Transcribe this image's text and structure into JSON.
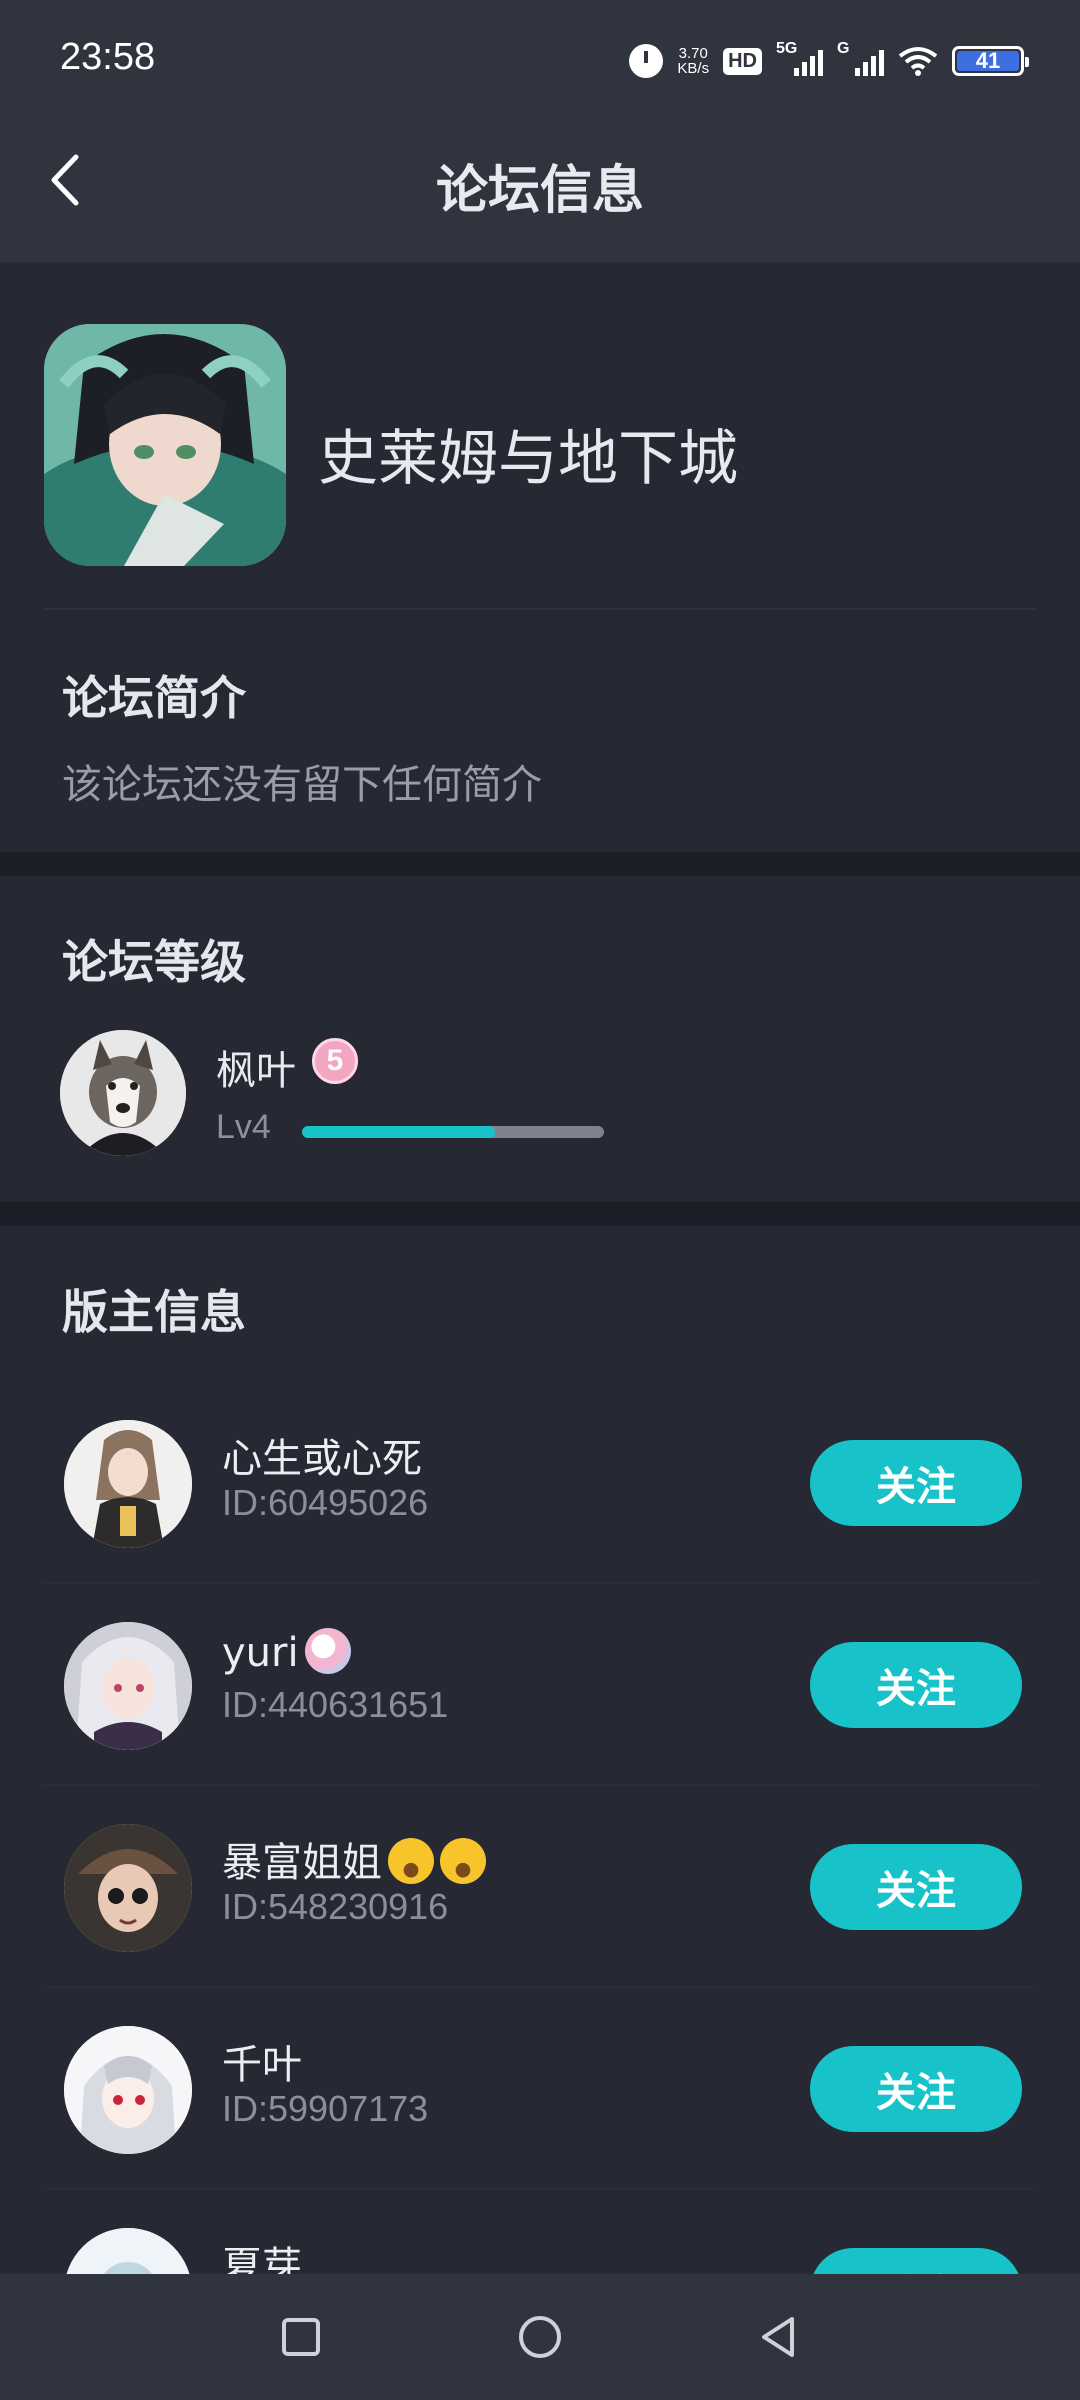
{
  "status_bar": {
    "time": "23:58",
    "speed_value": "3.70",
    "speed_unit": "KB/s",
    "hd_label": "HD",
    "network1_label": "5G",
    "network2_label": "G",
    "battery_level": "41",
    "icons": [
      "alarm-icon",
      "hd-icon",
      "signal-icon",
      "wifi-icon",
      "battery-icon"
    ]
  },
  "header": {
    "title": "论坛信息",
    "back_icon": "chevron-left-icon"
  },
  "forum": {
    "name": "史莱姆与地下城",
    "intro_title": "论坛简介",
    "intro_text": "该论坛还没有留下任何简介"
  },
  "level": {
    "section_title": "论坛等级",
    "user_name": "枫叶",
    "badge_number": "5",
    "level_label": "Lv4",
    "progress": 0.64
  },
  "moderators": {
    "section_title": "版主信息",
    "follow_label": "关注",
    "items": [
      {
        "name": "心生或心死",
        "id": "ID:60495026"
      },
      {
        "name": "yuri",
        "id": "ID:440631651"
      },
      {
        "name": "暴富姐姐",
        "id": "ID:548230916"
      },
      {
        "name": "千叶",
        "id": "ID:59907173"
      },
      {
        "name": "夏芽",
        "id": ""
      }
    ]
  },
  "colors": {
    "accent": "#17c3c9",
    "background": "#232530",
    "header": "#30343f"
  }
}
